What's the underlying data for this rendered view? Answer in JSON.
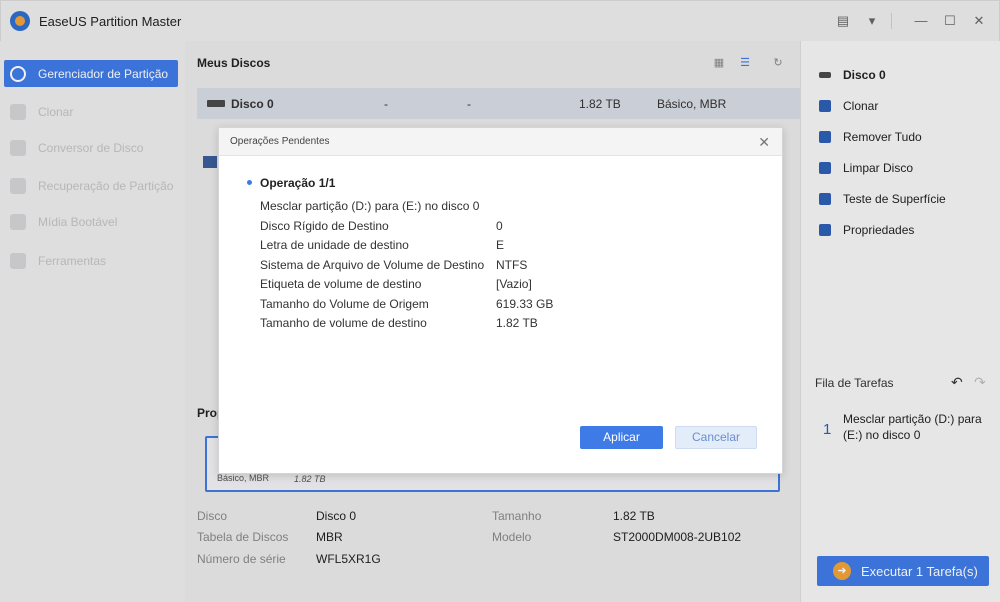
{
  "app": {
    "title": "EaseUS Partition Master"
  },
  "sidebar": {
    "items": [
      {
        "label": "Gerenciador de Partição"
      },
      {
        "label": "Clonar"
      },
      {
        "label": "Conversor de Disco"
      },
      {
        "label": "Recuperação de Partição"
      },
      {
        "label": "Mídia Bootável"
      },
      {
        "label": "Ferramentas"
      }
    ]
  },
  "main": {
    "title": "Meus Discos",
    "disk_row": {
      "name": "Disco 0",
      "dash1": "-",
      "dash2": "-",
      "size": "1.82 TB",
      "type": "Básico, MBR"
    },
    "properties_label": "Prop",
    "partition_box": {
      "type": "Básico, MBR",
      "size": "1.82 TB"
    },
    "info": {
      "disk_key": "Disco",
      "disk_val": "Disco 0",
      "table_key": "Tabela de Discos",
      "table_val": "MBR",
      "serial_key": "Número de série",
      "serial_val": "WFL5XR1G",
      "size_key": "Tamanho",
      "size_val": "1.82 TB",
      "model_key": "Modelo",
      "model_val": "ST2000DM008-2UB102"
    }
  },
  "right_panel": {
    "disk_label": "Disco 0",
    "actions": [
      "Clonar",
      "Remover Tudo",
      "Limpar Disco",
      "Teste de Superfície",
      "Propriedades"
    ],
    "queue_title": "Fila de Tarefas",
    "queue_item_number": "1",
    "queue_item_text": "Mesclar partição (D:) para (E:) no disco 0",
    "execute_label": "Executar 1 Tarefa(s)"
  },
  "dialog": {
    "title": "Operações Pendentes",
    "operation_title": "Operação 1/1",
    "summary": "Mesclar partição (D:) para (E:) no disco 0",
    "rows": [
      {
        "key": "Disco Rígido de Destino",
        "value": "0"
      },
      {
        "key": "Letra de unidade de destino",
        "value": "E"
      },
      {
        "key": "Sistema de Arquivo de Volume de Destino",
        "value": "NTFS"
      },
      {
        "key": "Etiqueta de volume de destino",
        "value": "[Vazio]"
      },
      {
        "key": "Tamanho do Volume de Origem",
        "value": "619.33 GB"
      },
      {
        "key": "Tamanho de volume de destino",
        "value": "1.82 TB"
      }
    ],
    "apply_label": "Aplicar",
    "cancel_label": "Cancelar"
  },
  "colors": {
    "accent": "#3f7be6",
    "execute_circle": "#f2a23a"
  }
}
